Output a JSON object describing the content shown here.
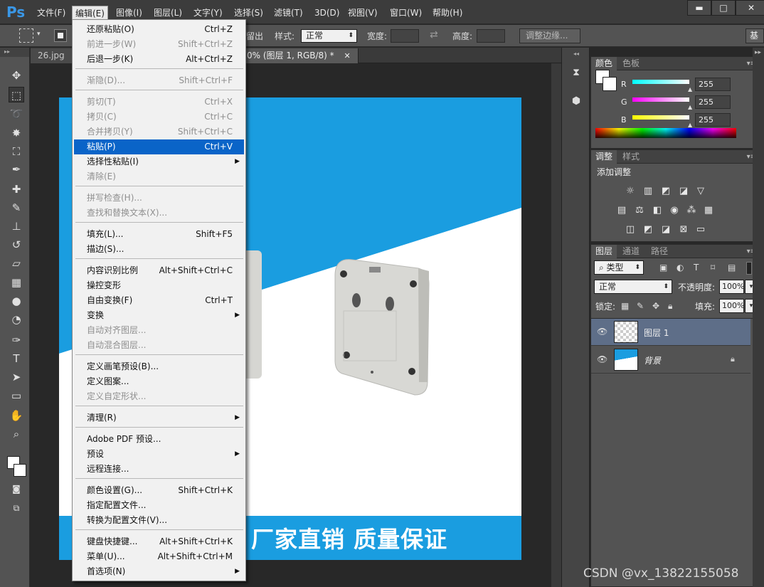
{
  "app": {
    "logo": "Ps"
  },
  "menubar": {
    "items": [
      {
        "label": "文件(F)"
      },
      {
        "label": "编辑(E)"
      },
      {
        "label": "图像(I)"
      },
      {
        "label": "图层(L)"
      },
      {
        "label": "文字(Y)"
      },
      {
        "label": "选择(S)"
      },
      {
        "label": "滤镜(T)"
      },
      {
        "label": "3D(D)"
      },
      {
        "label": "视图(V)"
      },
      {
        "label": "窗口(W)"
      },
      {
        "label": "帮助(H)"
      }
    ],
    "window_buttons": {
      "minimize": "▬",
      "maximize": "□",
      "close": "✕"
    }
  },
  "options_bar": {
    "partial_label": "留出",
    "style_label": "样式:",
    "style_value": "正常",
    "width_label": "宽度:",
    "height_label": "高度:",
    "refine_edge_button": "调整边缘...",
    "workspace_button": "基"
  },
  "document": {
    "tabs": [
      {
        "label": "26.jpg @"
      },
      {
        "label": "0% (图层 1, RGB/8) *",
        "close": "✕"
      }
    ],
    "banner_text": "厂家直销  质量保证"
  },
  "edit_menu": {
    "items": [
      {
        "label": "还原粘贴(O)",
        "shortcut": "Ctrl+Z",
        "disabled": false
      },
      {
        "label": "前进一步(W)",
        "shortcut": "Shift+Ctrl+Z",
        "disabled": true
      },
      {
        "label": "后退一步(K)",
        "shortcut": "Alt+Ctrl+Z",
        "disabled": false
      },
      {
        "label": "渐隐(D)...",
        "shortcut": "Shift+Ctrl+F",
        "disabled": true
      },
      {
        "label": "剪切(T)",
        "shortcut": "Ctrl+X",
        "disabled": true
      },
      {
        "label": "拷贝(C)",
        "shortcut": "Ctrl+C",
        "disabled": true
      },
      {
        "label": "合并拷贝(Y)",
        "shortcut": "Shift+Ctrl+C",
        "disabled": true
      },
      {
        "label": "粘贴(P)",
        "shortcut": "Ctrl+V",
        "disabled": false,
        "highlighted": true
      },
      {
        "label": "选择性粘贴(I)",
        "shortcut": "",
        "disabled": false,
        "submenu": true
      },
      {
        "label": "清除(E)",
        "shortcut": "",
        "disabled": true
      },
      {
        "label": "拼写检查(H)...",
        "shortcut": "",
        "disabled": true
      },
      {
        "label": "查找和替换文本(X)...",
        "shortcut": "",
        "disabled": true
      },
      {
        "label": "填充(L)...",
        "shortcut": "Shift+F5",
        "disabled": false
      },
      {
        "label": "描边(S)...",
        "shortcut": "",
        "disabled": false
      },
      {
        "label": "内容识别比例",
        "shortcut": "Alt+Shift+Ctrl+C",
        "disabled": false
      },
      {
        "label": "操控变形",
        "shortcut": "",
        "disabled": false
      },
      {
        "label": "自由变换(F)",
        "shortcut": "Ctrl+T",
        "disabled": false
      },
      {
        "label": "变换",
        "shortcut": "",
        "disabled": false,
        "submenu": true
      },
      {
        "label": "自动对齐图层...",
        "shortcut": "",
        "disabled": true
      },
      {
        "label": "自动混合图层...",
        "shortcut": "",
        "disabled": true
      },
      {
        "label": "定义画笔预设(B)...",
        "shortcut": "",
        "disabled": false
      },
      {
        "label": "定义图案...",
        "shortcut": "",
        "disabled": false
      },
      {
        "label": "定义自定形状...",
        "shortcut": "",
        "disabled": true
      },
      {
        "label": "清理(R)",
        "shortcut": "",
        "disabled": false,
        "submenu": true
      },
      {
        "label": "Adobe PDF 预设...",
        "shortcut": "",
        "disabled": false
      },
      {
        "label": "预设",
        "shortcut": "",
        "disabled": false,
        "submenu": true
      },
      {
        "label": "远程连接...",
        "shortcut": "",
        "disabled": false
      },
      {
        "label": "颜色设置(G)...",
        "shortcut": "Shift+Ctrl+K",
        "disabled": false
      },
      {
        "label": "指定配置文件...",
        "shortcut": "",
        "disabled": false
      },
      {
        "label": "转换为配置文件(V)...",
        "shortcut": "",
        "disabled": false
      },
      {
        "label": "键盘快捷键...",
        "shortcut": "Alt+Shift+Ctrl+K",
        "disabled": false
      },
      {
        "label": "菜单(U)...",
        "shortcut": "Alt+Shift+Ctrl+M",
        "disabled": false
      },
      {
        "label": "首选项(N)",
        "shortcut": "",
        "disabled": false,
        "submenu": true
      }
    ]
  },
  "color_panel": {
    "tabs": [
      "颜色",
      "色板"
    ],
    "sliders": [
      {
        "label": "R",
        "value": "255",
        "color": "#00ffff"
      },
      {
        "label": "G",
        "value": "255",
        "color": "#ff00ff"
      },
      {
        "label": "B",
        "value": "255",
        "color": "#ffff00"
      }
    ]
  },
  "adjustments_panel": {
    "tabs": [
      "调整",
      "样式"
    ],
    "title": "添加调整"
  },
  "layers_panel": {
    "tabs": [
      "图层",
      "通道",
      "路径"
    ],
    "filter_kind": "类型",
    "blend_mode": "正常",
    "opacity_label": "不透明度:",
    "opacity_value": "100%",
    "lock_label": "锁定:",
    "fill_label": "填充:",
    "fill_value": "100%",
    "layers": [
      {
        "name": "图层 1",
        "selected": true
      },
      {
        "name": "背景",
        "selected": false,
        "locked": true
      }
    ]
  },
  "watermark": "CSDN @vx_13822155058",
  "colors": {
    "accent_blue": "#1a9de0",
    "menu_highlight": "#0a64c8",
    "ps_blue": "#3a97e6"
  }
}
